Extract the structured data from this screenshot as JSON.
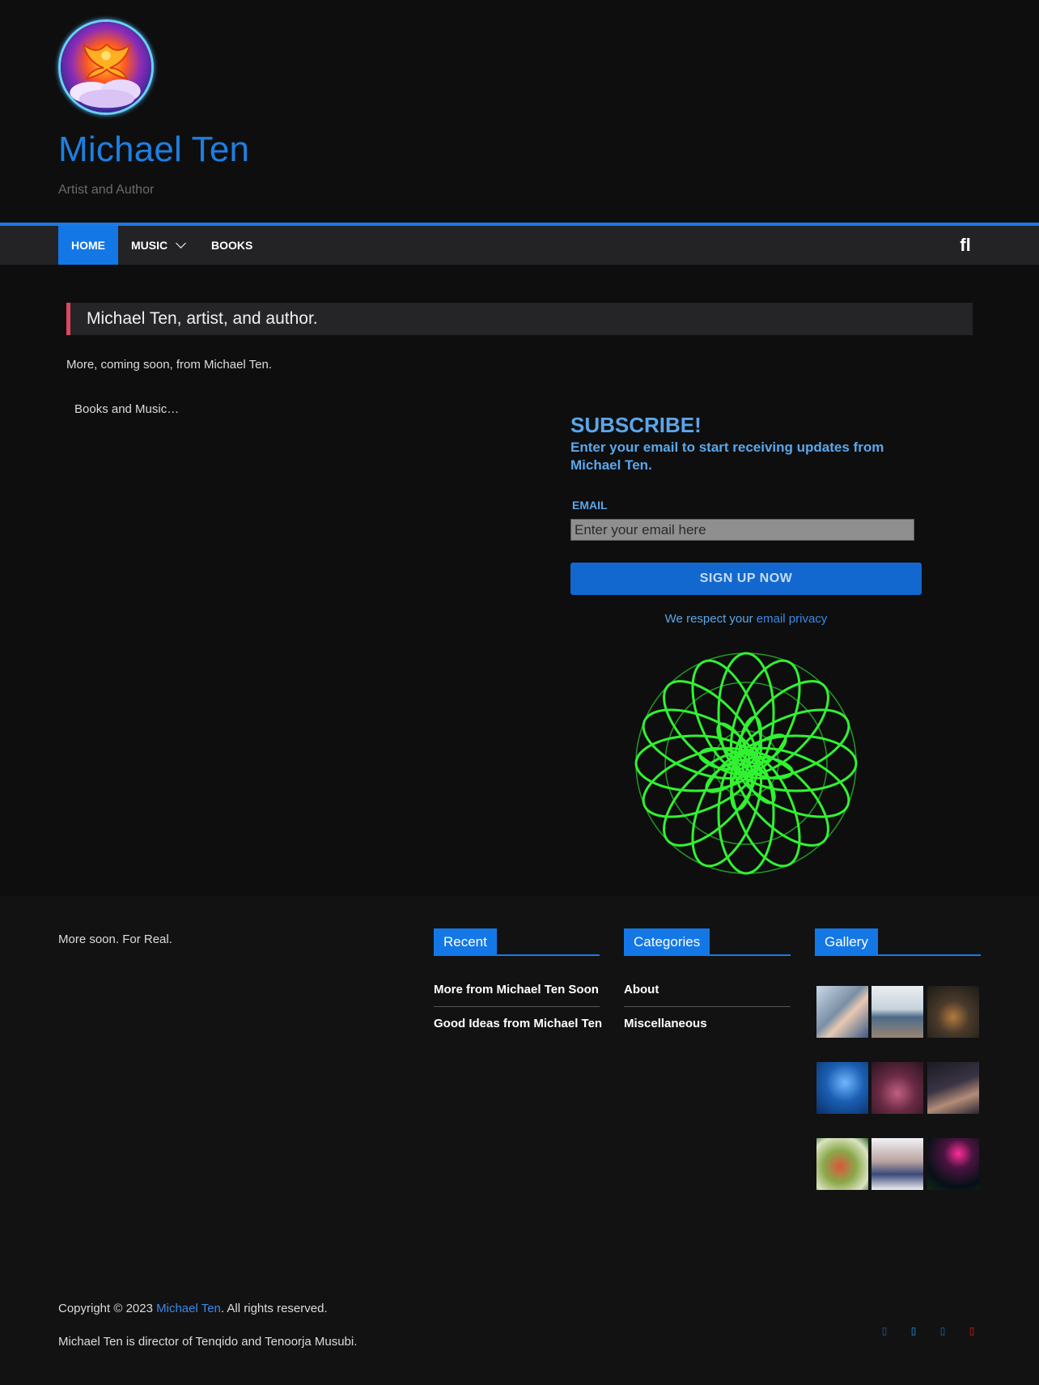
{
  "site": {
    "title": "Michael Ten",
    "tagline": "Artist and Author"
  },
  "nav": {
    "items": [
      {
        "label": "HOME"
      },
      {
        "label": "MUSIC"
      },
      {
        "label": "BOOKS"
      }
    ],
    "search_glyph": "fl"
  },
  "main": {
    "heading": "Michael Ten, artist, and author.",
    "intro": "More, coming soon, from Michael Ten.",
    "books_music": "Books and Music…"
  },
  "subscribe": {
    "title": "SUBSCRIBE!",
    "description": "Enter your email to start receiving updates from Michael Ten.",
    "email_label": "EMAIL",
    "email_placeholder": "Enter your email here",
    "button_label": "SIGN UP NOW",
    "privacy_prefix": "We respect your",
    "privacy_link": "email privacy"
  },
  "footer": {
    "text": "More soon. For Real.",
    "recent": {
      "title": "Recent",
      "items": [
        "More from Michael Ten Soon",
        "Good Ideas from Michael Ten"
      ]
    },
    "categories": {
      "title": "Categories",
      "items": [
        "About",
        "Miscellaneous"
      ]
    },
    "gallery": {
      "title": "Gallery"
    },
    "copyright_prefix": "Copyright © 2023",
    "copyright_link": "Michael Ten",
    "copyright_suffix": ". All rights reserved.",
    "director": "Michael Ten is director of Tenqido and Tenoorja Musubi."
  },
  "colors": {
    "accent": "#1477e6",
    "heading_bar": "#e0465a",
    "subscribe_text": "#5aa7ea",
    "mandala": "#33ff33"
  },
  "icons": [
    "search-icon",
    "chevron-down-icon",
    "facebook-icon",
    "twitter-icon",
    "linkedin-icon",
    "youtube-icon"
  ]
}
